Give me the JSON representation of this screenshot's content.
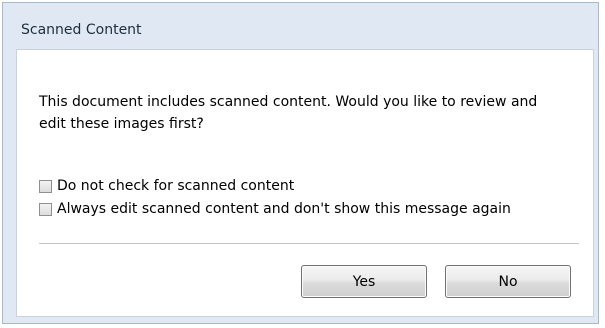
{
  "dialog": {
    "title": "Scanned Content",
    "message": "This document includes scanned content. Would you like to review and edit these images first?",
    "options": [
      {
        "label": "Do not check for scanned content",
        "checked": false
      },
      {
        "label": "Always edit scanned content and don't show this message again",
        "checked": false
      }
    ],
    "buttons": {
      "yes_label": "Yes",
      "no_label": "No"
    }
  },
  "colors": {
    "frame_background": "#dfe8f3",
    "content_background": "#ffffff",
    "button_border": "#707070"
  }
}
